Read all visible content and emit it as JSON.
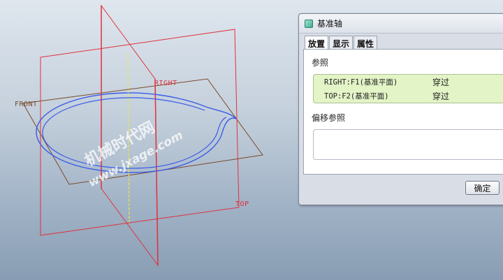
{
  "viewport": {
    "planes": {
      "front_label": "FRONT",
      "right_label": "RIGHT",
      "top_label": "TOP"
    },
    "watermark": {
      "line1": "机械时代网",
      "line2": "www.jxage.com"
    },
    "colors": {
      "front_plane": "#7a4a2a",
      "datum_red": "#e0303c",
      "sketch_blue": "#3a5ce8",
      "axis_yellow": "#e8e840",
      "watermark": "#ffffff"
    }
  },
  "dialog": {
    "title": "基准轴",
    "icon": "datum-axis-icon",
    "tabs": [
      {
        "label": "放置",
        "active": true
      },
      {
        "label": "显示",
        "active": false
      },
      {
        "label": "属性",
        "active": false
      }
    ],
    "references_label": "参照",
    "references": [
      {
        "name": "RIGHT:F1(基准平面)",
        "constraint": "穿过"
      },
      {
        "name": "TOP:F2(基准平面)",
        "constraint": "穿过"
      }
    ],
    "offset_references_label": "偏移参照",
    "ok_label": "确定",
    "colors": {
      "reference_box": "#e3f4c6"
    }
  }
}
